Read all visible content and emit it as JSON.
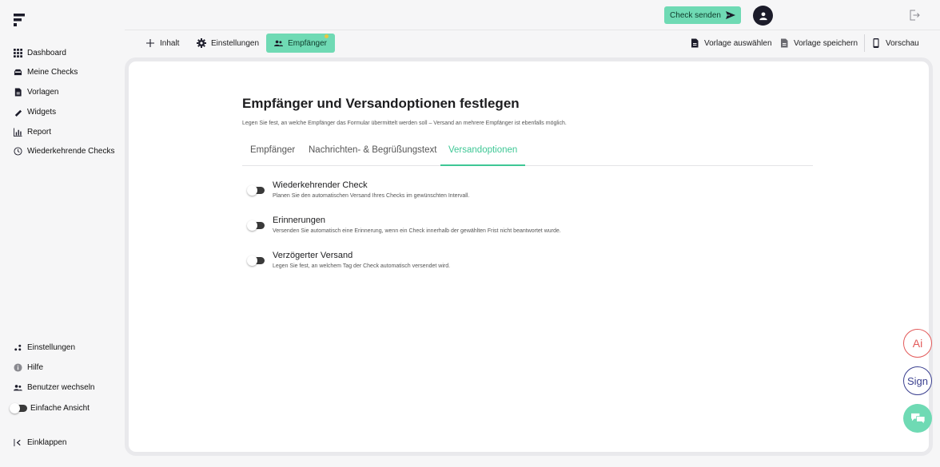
{
  "sidebar": {
    "logo_icon": "brand-logo-icon",
    "items": [
      {
        "label": "Dashboard",
        "icon": "grid-icon"
      },
      {
        "label": "Meine Checks",
        "icon": "inbox-icon"
      },
      {
        "label": "Vorlagen",
        "icon": "document-icon"
      },
      {
        "label": "Widgets",
        "icon": "puzzle-icon"
      },
      {
        "label": "Report",
        "icon": "bar-chart-icon"
      },
      {
        "label": "Wiederkehrende Checks",
        "icon": "clock-icon"
      }
    ],
    "bottom": [
      {
        "label": "Einstellungen",
        "icon": "settings-icon"
      },
      {
        "label": "Hilfe",
        "icon": "info-icon"
      },
      {
        "label": "Benutzer wechseln",
        "icon": "users-icon"
      },
      {
        "label": "Einfache Ansicht",
        "icon": "toggle-icon"
      },
      {
        "label": "Einklappen",
        "icon": "collapse-icon"
      }
    ]
  },
  "topbar": {
    "send_label": "Check senden",
    "send_icon": "send-icon",
    "avatar_icon": "user-avatar-icon",
    "logout_icon": "logout-icon"
  },
  "toolbar": {
    "tabs": [
      {
        "label": "Inhalt",
        "icon": "plus-icon"
      },
      {
        "label": "Einstellungen",
        "icon": "gear-icon"
      },
      {
        "label": "Empfänger",
        "icon": "recipients-icon",
        "active": true
      }
    ],
    "actions": [
      {
        "label": "Vorlage auswählen",
        "icon": "template-icon"
      },
      {
        "label": "Vorlage speichern",
        "icon": "save-template-icon"
      },
      {
        "label": "Vorschau",
        "icon": "phone-icon"
      }
    ]
  },
  "main": {
    "title": "Empfänger und Versandoptionen festlegen",
    "subtitle": "Legen Sie fest, an welche Empfänger das Formular übermittelt werden soll – Versand an mehrere Empfänger ist ebenfalls möglich.",
    "tabs": [
      {
        "label": "Empfänger",
        "active": false
      },
      {
        "label": "Nachrichten- & Begrüßungstext",
        "active": false
      },
      {
        "label": "Versandoptionen",
        "active": true
      }
    ],
    "options": [
      {
        "title": "Wiederkehrender Check",
        "description": "Planen Sie den automatischen Versand Ihres Checks im gewünschten Intervall.",
        "enabled": false
      },
      {
        "title": "Erinnerungen",
        "description": "Versenden Sie automatisch eine Erinnerung, wenn ein Check innerhalb der gewählten Frist nicht beantwortet wurde.",
        "enabled": false
      },
      {
        "title": "Verzögerter Versand",
        "description": "Legen Sie fest, an welchem Tag der Check automatisch versendet wird.",
        "enabled": false
      }
    ]
  },
  "floating": {
    "ai_label": "Ai",
    "sign_label": "Sign",
    "chat_icon": "chat-icon"
  },
  "colors": {
    "accent": "#6fdab4",
    "accent_text": "#3ec795",
    "ai": "#e35a5a",
    "sign": "#3a3f8f"
  }
}
